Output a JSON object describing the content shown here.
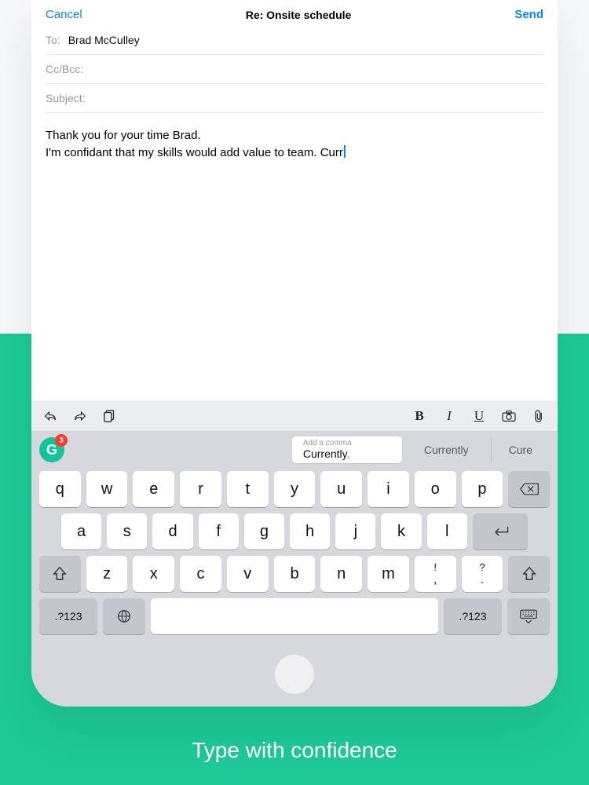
{
  "tagline": "Type with confidence",
  "nav": {
    "cancel": "Cancel",
    "title": "Re: Onsite schedule",
    "send": "Send"
  },
  "fields": {
    "to_label": "To:",
    "to_value": "Brad McCulley",
    "cc_label": "Cc/Bcc:",
    "cc_value": "",
    "subject_label": "Subject:",
    "subject_value": ""
  },
  "body": {
    "line1": "Thank you for your time Brad.",
    "line2": "I'm confidant that my skills would add value to team. Curr"
  },
  "toolbar": {
    "bold": "B",
    "italic": "I",
    "underline": "U"
  },
  "grammarly": {
    "badge_count": "3",
    "logo_letter": "G"
  },
  "suggestions": {
    "hint": "Add a comma",
    "primary_word": "Currently",
    "primary_punct": ",",
    "alt1": "Currently",
    "alt2": "Cure"
  },
  "keys": {
    "row1": [
      "q",
      "w",
      "e",
      "r",
      "t",
      "y",
      "u",
      "i",
      "o",
      "p"
    ],
    "row2": [
      "a",
      "s",
      "d",
      "f",
      "g",
      "h",
      "j",
      "k",
      "l"
    ],
    "row3": [
      "z",
      "x",
      "c",
      "v",
      "b",
      "n",
      "m"
    ],
    "punct1_top": "!",
    "punct1_bot": ",",
    "punct2_top": "?",
    "punct2_bot": ".",
    "sym": ".?123"
  }
}
